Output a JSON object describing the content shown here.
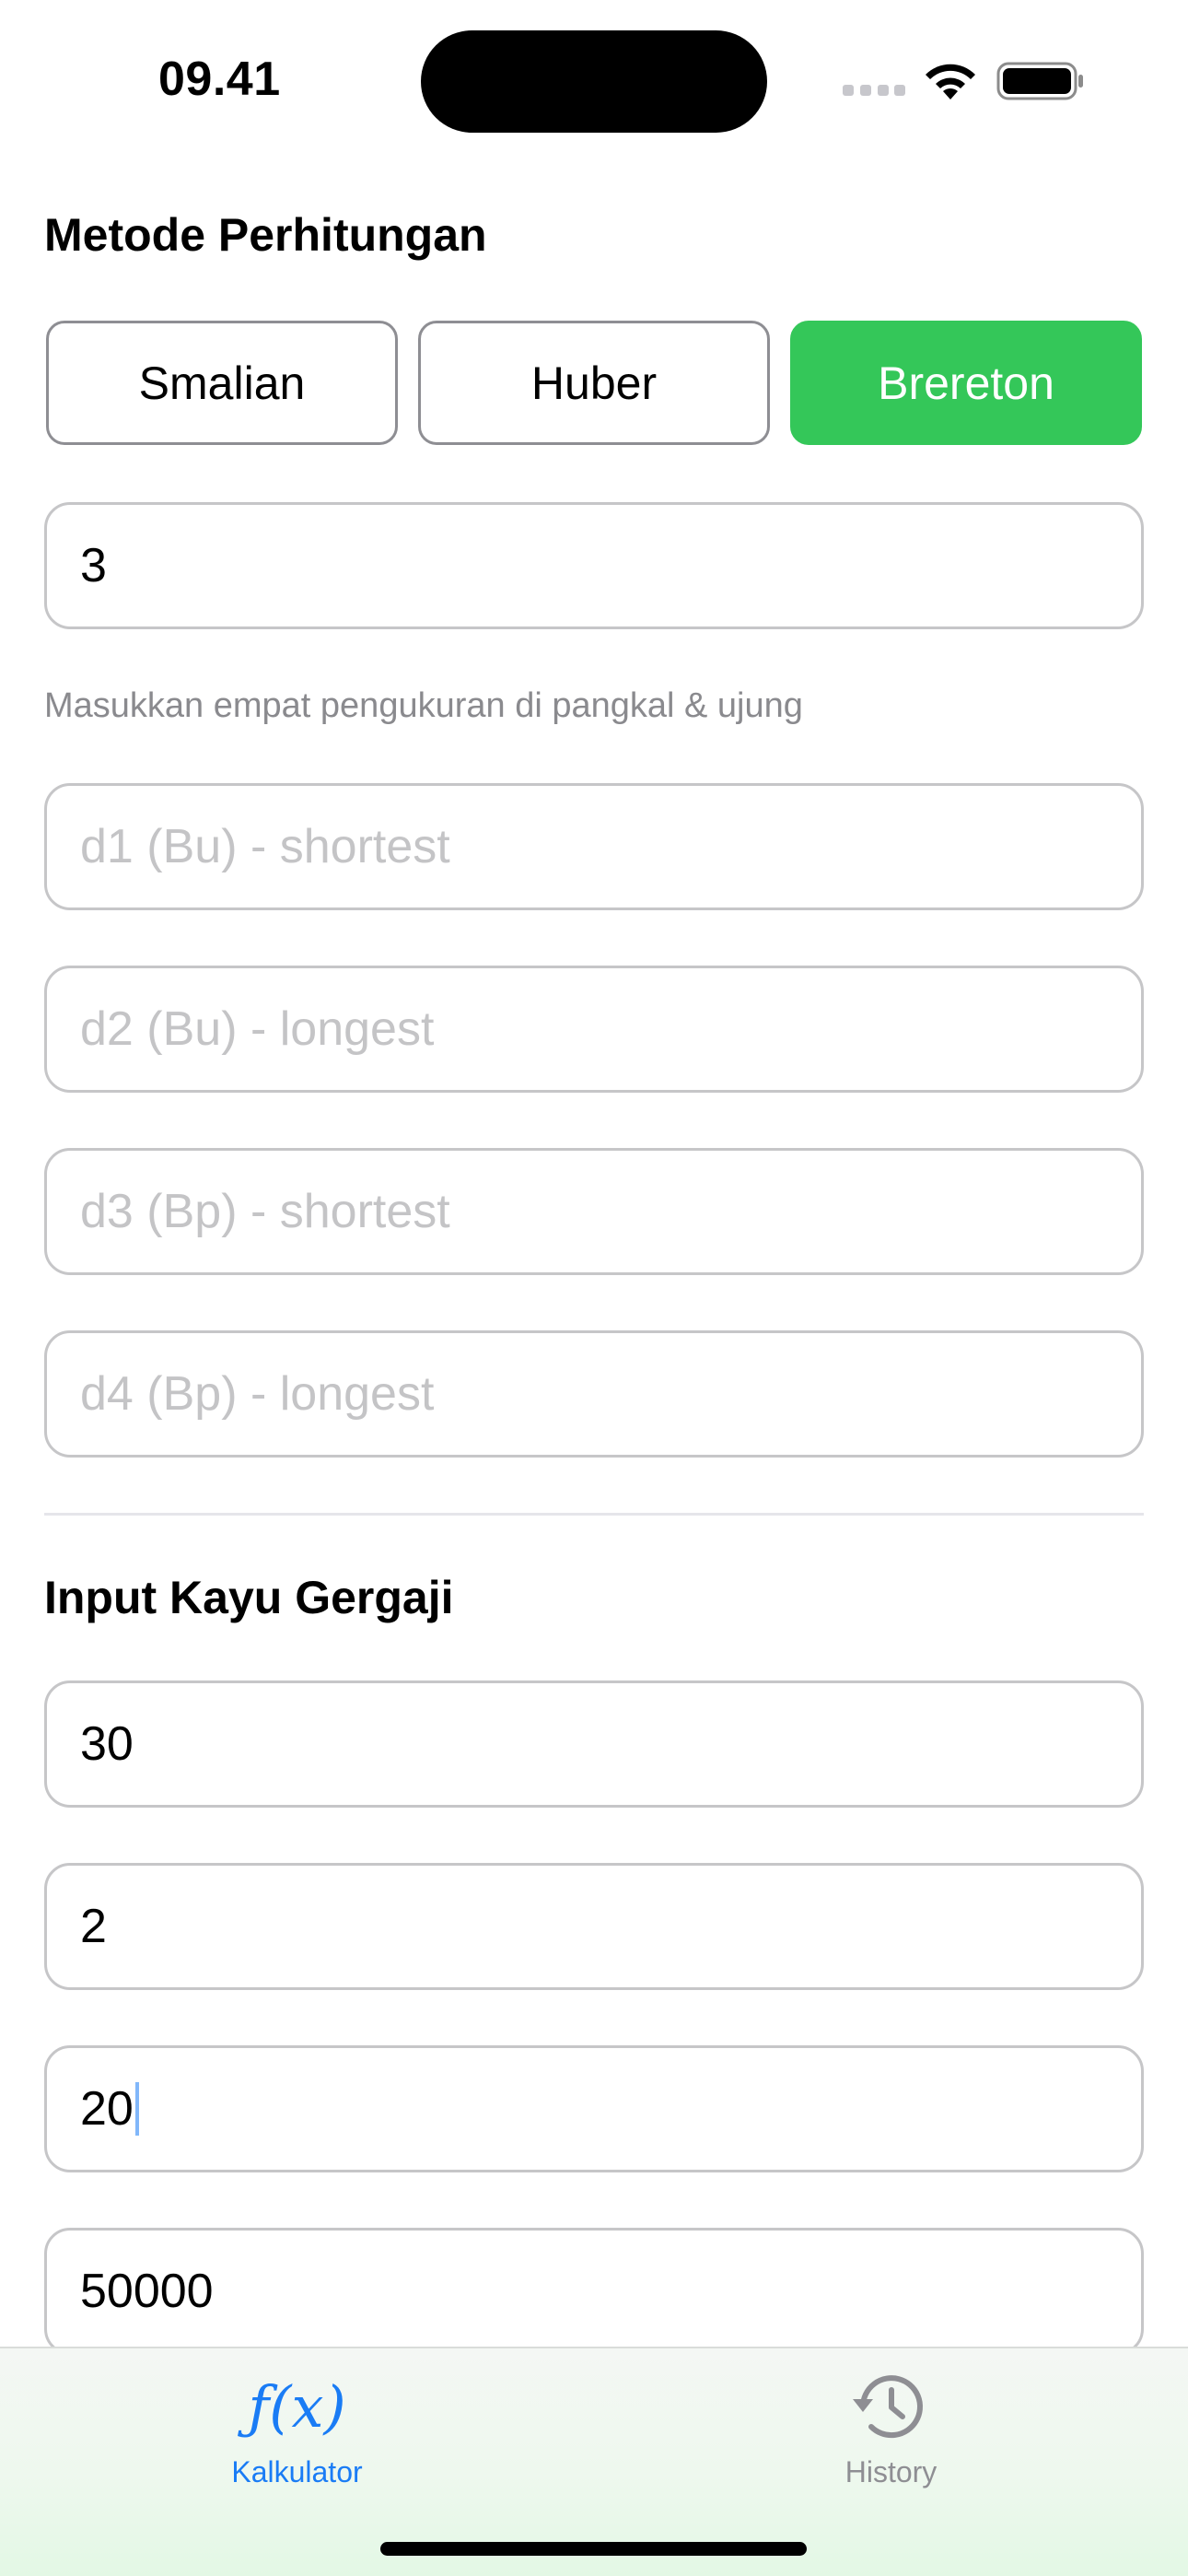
{
  "status_bar": {
    "time": "09.41"
  },
  "method_section": {
    "title": "Metode Perhitungan",
    "options": [
      {
        "label": "Smalian",
        "selected": false
      },
      {
        "label": "Huber",
        "selected": false
      },
      {
        "label": "Brereton",
        "selected": true
      }
    ],
    "length_value": "3",
    "hint": "Masukkan empat pengukuran di pangkal & ujung",
    "diameter_fields": [
      {
        "value": "",
        "placeholder": "d1 (Bu) - shortest"
      },
      {
        "value": "",
        "placeholder": "d2 (Bu) - longest"
      },
      {
        "value": "",
        "placeholder": "d3 (Bp) - shortest"
      },
      {
        "value": "",
        "placeholder": "d4 (Bp) - longest"
      }
    ]
  },
  "sawn_wood_section": {
    "title": "Input Kayu Gergaji",
    "fields": [
      {
        "value": "30"
      },
      {
        "value": "2"
      },
      {
        "value": "20",
        "focused": true
      },
      {
        "value": "50000"
      }
    ]
  },
  "tab_bar": {
    "tabs": [
      {
        "label": "Kalkulator",
        "icon": "function-fx-icon",
        "icon_text": "ƒ(x)",
        "active": true
      },
      {
        "label": "History",
        "icon": "clock-history-icon",
        "active": false
      }
    ]
  },
  "colors": {
    "accent_green": "#34c759",
    "accent_blue": "#1a7cf5",
    "inactive_gray": "#8e8e93"
  }
}
